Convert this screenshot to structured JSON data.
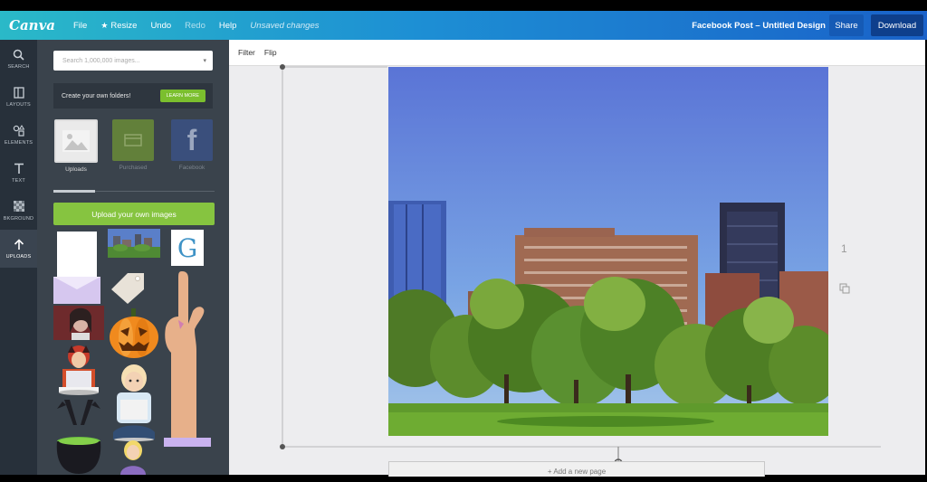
{
  "topbar": {
    "logo": "Canva",
    "menu": {
      "file": "File",
      "resize": "Resize",
      "undo": "Undo",
      "redo": "Redo",
      "help": "Help",
      "status": "Unsaved changes"
    },
    "document_title": "Facebook Post – Untitled Design",
    "share_label": "Share",
    "download_label": "Download"
  },
  "sidebar": {
    "items": [
      {
        "label": "SEARCH",
        "icon": "search-icon"
      },
      {
        "label": "LAYOUTS",
        "icon": "layouts-icon"
      },
      {
        "label": "ELEMENTS",
        "icon": "elements-icon"
      },
      {
        "label": "TEXT",
        "icon": "text-icon"
      },
      {
        "label": "BKGROUND",
        "icon": "background-icon"
      },
      {
        "label": "UPLOADS",
        "icon": "upload-arrow-icon"
      }
    ]
  },
  "panel": {
    "search": {
      "placeholder": "Search 1,000,000 images..."
    },
    "folders_text": "Create your own folders!",
    "learn_more": "LEARN MORE",
    "tabs": [
      {
        "label": "Uploads"
      },
      {
        "label": "Purchased"
      },
      {
        "label": "Facebook"
      }
    ],
    "upload_button": "Upload your own images"
  },
  "workspace": {
    "toolbar": {
      "filter": "Filter",
      "flip": "Flip"
    },
    "page_number": "1",
    "add_page": "+ Add a new page"
  },
  "colors": {
    "brand_gradient_start": "#2ab9c8",
    "brand_gradient_end": "#1a62c9",
    "upload_green": "#86c440",
    "panel_bg": "#3a434c"
  }
}
